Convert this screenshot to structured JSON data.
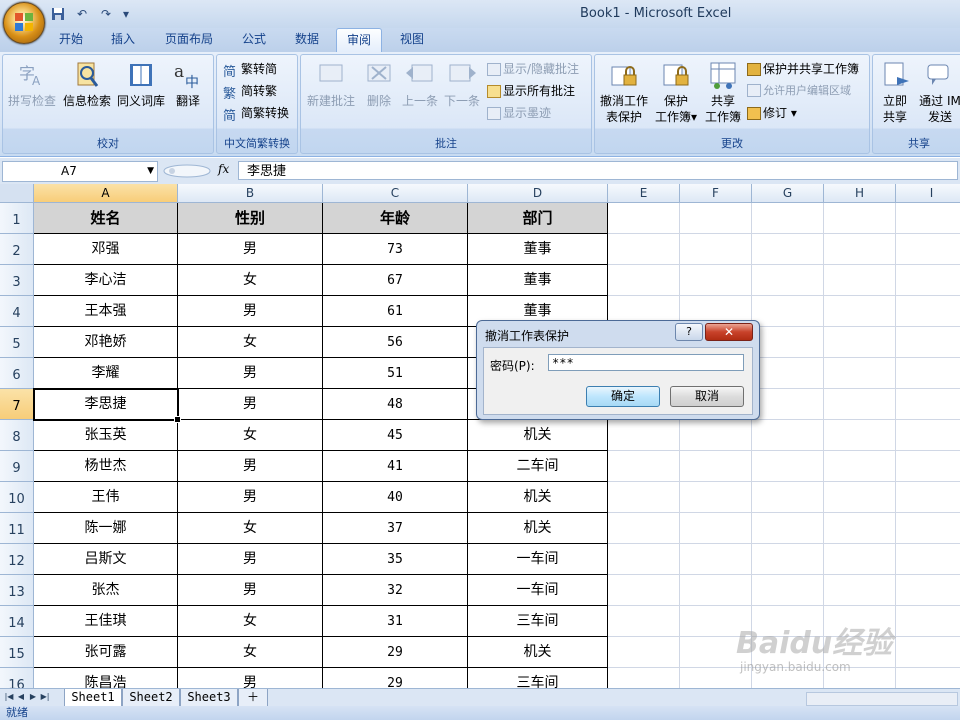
{
  "window": {
    "title": "Book1 - Microsoft Excel"
  },
  "tabs": [
    {
      "label": "开始"
    },
    {
      "label": "插入"
    },
    {
      "label": "页面布局"
    },
    {
      "label": "公式"
    },
    {
      "label": "数据"
    },
    {
      "label": "审阅"
    },
    {
      "label": "视图"
    }
  ],
  "active_tab": "审阅",
  "ribbon": {
    "proofing": {
      "label": "校对",
      "spell": "拼写检查",
      "research": "信息检索",
      "thesaurus": "同义词库",
      "translate": "翻译"
    },
    "chinese": {
      "label": "中文简繁转换",
      "to_simplified": "繁转简",
      "to_traditional": "简转繁",
      "convert": "简繁转换"
    },
    "comments": {
      "label": "批注",
      "new": "新建批注",
      "delete": "删除",
      "prev": "上一条",
      "next": "下一条",
      "show_hide": "显示/隐藏批注",
      "show_all": "显示所有批注",
      "show_ink": "显示墨迹"
    },
    "changes": {
      "label": "更改",
      "unprotect_l1": "撤消工作",
      "unprotect_l2": "表保护",
      "protect_wb_l1": "保护",
      "protect_wb_l2": "工作簿",
      "share_wb_l1": "共享",
      "share_wb_l2": "工作簿",
      "protect_share": "保护并共享工作簿",
      "allow_edit": "允许用户编辑区域",
      "track": "修订"
    },
    "share": {
      "label": "共享",
      "share_now_l1": "立即",
      "share_now_l2": "共享",
      "send_im_l1": "通过 IM",
      "send_im_l2": "发送"
    }
  },
  "formula_bar": {
    "name_box": "A7",
    "fx": "fx",
    "content": "李思捷"
  },
  "columns": [
    "A",
    "B",
    "C",
    "D",
    "E",
    "F",
    "G",
    "H",
    "I"
  ],
  "rows": [
    "1",
    "2",
    "3",
    "4",
    "5",
    "6",
    "7",
    "8",
    "9",
    "10",
    "11",
    "12",
    "13",
    "14",
    "15",
    "16"
  ],
  "table": {
    "headers": [
      "姓名",
      "性别",
      "年龄",
      "部门"
    ],
    "records": [
      [
        "邓强",
        "男",
        "73",
        "董事"
      ],
      [
        "李心洁",
        "女",
        "67",
        "董事"
      ],
      [
        "王本强",
        "男",
        "61",
        "董事"
      ],
      [
        "邓艳娇",
        "女",
        "56",
        ""
      ],
      [
        "李耀",
        "男",
        "51",
        ""
      ],
      [
        "李思捷",
        "男",
        "48",
        ""
      ],
      [
        "张玉英",
        "女",
        "45",
        "机关"
      ],
      [
        "杨世杰",
        "男",
        "41",
        "二车间"
      ],
      [
        "王伟",
        "男",
        "40",
        "机关"
      ],
      [
        "陈一娜",
        "女",
        "37",
        "机关"
      ],
      [
        "吕斯文",
        "男",
        "35",
        "一车间"
      ],
      [
        "张杰",
        "男",
        "32",
        "一车间"
      ],
      [
        "王佳琪",
        "女",
        "31",
        "三车间"
      ],
      [
        "张可露",
        "女",
        "29",
        "机关"
      ],
      [
        "陈昌浩",
        "男",
        "29",
        "三车间"
      ]
    ]
  },
  "dialog": {
    "title": "撤消工作表保护",
    "help": "?",
    "close": "✕",
    "password_label": "密码(P):",
    "password_value": "***",
    "ok": "确定",
    "cancel": "取消"
  },
  "sheets": [
    "Sheet1",
    "Sheet2",
    "Sheet3"
  ],
  "status": "就绪",
  "watermark": {
    "brand": "Baidu经验",
    "url": "jingyan.baidu.com"
  }
}
